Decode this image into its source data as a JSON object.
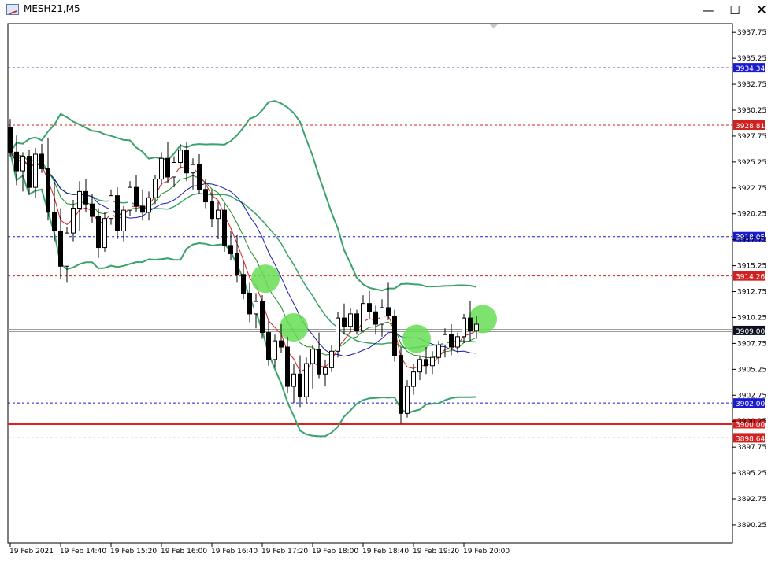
{
  "window": {
    "title": "MESH21,M5",
    "minimize_glyph": "—",
    "maximize_glyph": "☐",
    "close_glyph": "✕"
  },
  "colors": {
    "background": "#ffffff",
    "grid": "#000000",
    "bollinger": "#3aa36a",
    "ma_fast": "#d22020",
    "ma_mid": "#1e8a1e",
    "ma_slow": "#1a1aa8",
    "support_line": "#e02020",
    "highlight": "#66dd55",
    "level_blue": "#1a1ad0",
    "level_red": "#d02020",
    "bid_label_bg": "#0c1020"
  },
  "chart_data": {
    "type": "candlestick",
    "symbol_timeframe": "MESH21,M5",
    "y_axis": {
      "ticks": [
        "3937.75",
        "3935.25",
        "3932.75",
        "3930.25",
        "3927.75",
        "3925.25",
        "3922.75",
        "3920.25",
        "3917.75",
        "3915.25",
        "3912.75",
        "3910.25",
        "3907.75",
        "3905.25",
        "3902.75",
        "3900.25",
        "3897.75",
        "3895.25",
        "3892.75",
        "3890.25"
      ],
      "range": [
        3888.5,
        3938.6
      ]
    },
    "x_axis": {
      "labels": [
        "19 Feb 2021",
        "19 Feb 14:40",
        "19 Feb 15:20",
        "19 Feb 16:00",
        "19 Feb 16:40",
        "19 Feb 17:20",
        "19 Feb 18:00",
        "19 Feb 18:40",
        "19 Feb 19:20",
        "19 Feb 20:00"
      ],
      "label_bar_index": [
        0,
        8,
        16,
        24,
        32,
        40,
        48,
        56,
        64,
        72
      ]
    },
    "levels": [
      {
        "value": 3934.34,
        "label": "3934.34",
        "kind": "blue"
      },
      {
        "value": 3928.81,
        "label": "3928.81",
        "kind": "red"
      },
      {
        "value": 3918.05,
        "label": "3918.05",
        "kind": "blue"
      },
      {
        "value": 3914.26,
        "label": "3914.26",
        "kind": "red"
      },
      {
        "value": 3902.0,
        "label": "3902.00",
        "kind": "blue"
      },
      {
        "value": 3900.0,
        "label": "3900.00",
        "kind": "support"
      },
      {
        "value": 3898.64,
        "label": "3898.64",
        "kind": "red"
      }
    ],
    "bid": {
      "value": 3909.0,
      "label": "3909.00"
    },
    "highlights": [
      {
        "bar": 40.5,
        "price": 3914.0
      },
      {
        "bar": 45.0,
        "price": 3909.3
      },
      {
        "bar": 64.5,
        "price": 3908.2
      },
      {
        "bar": 75.0,
        "price": 3910.1
      }
    ],
    "ohlc": [
      [
        3928.6,
        3929.4,
        3925.8,
        3926.2
      ],
      [
        3926.2,
        3927.8,
        3923.0,
        3924.4
      ],
      [
        3924.4,
        3926.2,
        3922.4,
        3925.8
      ],
      [
        3925.8,
        3926.4,
        3922.2,
        3922.8
      ],
      [
        3922.8,
        3926.6,
        3921.8,
        3926.0
      ],
      [
        3926.0,
        3927.0,
        3924.2,
        3924.6
      ],
      [
        3924.6,
        3927.6,
        3919.6,
        3920.4
      ],
      [
        3920.4,
        3923.6,
        3917.6,
        3918.6
      ],
      [
        3918.6,
        3920.8,
        3914.0,
        3915.2
      ],
      [
        3915.2,
        3919.0,
        3913.6,
        3918.4
      ],
      [
        3918.4,
        3921.6,
        3917.6,
        3920.8
      ],
      [
        3920.8,
        3923.4,
        3918.6,
        3922.4
      ],
      [
        3922.4,
        3923.6,
        3920.4,
        3921.2
      ],
      [
        3921.2,
        3922.2,
        3919.4,
        3920.0
      ],
      [
        3920.0,
        3920.8,
        3916.0,
        3917.0
      ],
      [
        3917.0,
        3920.4,
        3916.6,
        3919.8
      ],
      [
        3919.8,
        3922.6,
        3919.2,
        3922.0
      ],
      [
        3922.0,
        3922.8,
        3917.8,
        3918.6
      ],
      [
        3918.6,
        3921.0,
        3917.6,
        3920.6
      ],
      [
        3920.6,
        3923.4,
        3920.0,
        3922.8
      ],
      [
        3922.8,
        3924.0,
        3920.4,
        3921.0
      ],
      [
        3921.0,
        3922.6,
        3919.6,
        3920.4
      ],
      [
        3920.4,
        3922.4,
        3919.6,
        3921.8
      ],
      [
        3921.8,
        3924.0,
        3921.2,
        3923.6
      ],
      [
        3923.6,
        3926.2,
        3923.0,
        3925.6
      ],
      [
        3925.6,
        3927.2,
        3923.2,
        3923.8
      ],
      [
        3923.8,
        3925.8,
        3922.8,
        3925.2
      ],
      [
        3925.2,
        3927.0,
        3924.6,
        3926.4
      ],
      [
        3926.4,
        3927.2,
        3923.4,
        3924.2
      ],
      [
        3924.2,
        3925.6,
        3922.6,
        3925.0
      ],
      [
        3925.0,
        3926.0,
        3922.2,
        3922.6
      ],
      [
        3922.6,
        3923.6,
        3920.8,
        3921.4
      ],
      [
        3921.4,
        3922.6,
        3919.0,
        3919.8
      ],
      [
        3919.8,
        3921.4,
        3917.8,
        3920.6
      ],
      [
        3920.6,
        3921.2,
        3916.6,
        3917.2
      ],
      [
        3917.2,
        3918.6,
        3915.8,
        3916.4
      ],
      [
        3916.4,
        3918.2,
        3913.6,
        3914.4
      ],
      [
        3914.4,
        3915.6,
        3912.0,
        3912.6
      ],
      [
        3912.6,
        3913.6,
        3909.8,
        3910.6
      ],
      [
        3910.6,
        3912.6,
        3909.2,
        3911.8
      ],
      [
        3911.8,
        3912.4,
        3908.2,
        3908.8
      ],
      [
        3908.8,
        3910.0,
        3905.6,
        3906.2
      ],
      [
        3906.2,
        3908.6,
        3905.4,
        3908.0
      ],
      [
        3908.0,
        3909.6,
        3906.8,
        3907.4
      ],
      [
        3907.4,
        3908.4,
        3903.0,
        3903.6
      ],
      [
        3903.6,
        3905.8,
        3902.0,
        3904.8
      ],
      [
        3904.8,
        3906.6,
        3901.6,
        3902.6
      ],
      [
        3902.6,
        3906.4,
        3902.0,
        3905.8
      ],
      [
        3905.8,
        3907.6,
        3903.4,
        3907.2
      ],
      [
        3907.2,
        3908.8,
        3904.4,
        3904.8
      ],
      [
        3904.8,
        3906.2,
        3903.6,
        3905.4
      ],
      [
        3905.4,
        3907.6,
        3905.0,
        3907.0
      ],
      [
        3907.0,
        3910.8,
        3906.4,
        3910.2
      ],
      [
        3910.2,
        3911.6,
        3908.6,
        3909.4
      ],
      [
        3909.4,
        3911.2,
        3908.8,
        3910.6
      ],
      [
        3910.6,
        3911.0,
        3908.6,
        3909.0
      ],
      [
        3909.0,
        3912.4,
        3908.8,
        3911.6
      ],
      [
        3911.6,
        3912.8,
        3910.2,
        3910.8
      ],
      [
        3910.8,
        3911.4,
        3908.6,
        3909.6
      ],
      [
        3909.6,
        3912.0,
        3908.4,
        3911.2
      ],
      [
        3911.2,
        3913.6,
        3910.0,
        3910.4
      ],
      [
        3910.4,
        3911.0,
        3906.0,
        3906.6
      ],
      [
        3906.6,
        3907.4,
        3900.0,
        3901.0
      ],
      [
        3901.0,
        3904.2,
        3900.6,
        3903.6
      ],
      [
        3903.6,
        3905.8,
        3902.8,
        3905.0
      ],
      [
        3905.0,
        3906.6,
        3904.2,
        3906.2
      ],
      [
        3906.2,
        3907.4,
        3904.8,
        3905.6
      ],
      [
        3905.6,
        3907.0,
        3904.8,
        3906.4
      ],
      [
        3906.4,
        3908.0,
        3905.8,
        3907.6
      ],
      [
        3907.6,
        3909.2,
        3906.4,
        3908.6
      ],
      [
        3908.6,
        3909.6,
        3906.6,
        3907.4
      ],
      [
        3907.4,
        3908.8,
        3906.8,
        3908.4
      ],
      [
        3908.4,
        3910.6,
        3907.8,
        3910.2
      ],
      [
        3910.2,
        3911.8,
        3908.0,
        3909.0
      ],
      [
        3909.0,
        3910.4,
        3908.2,
        3909.6
      ]
    ]
  }
}
